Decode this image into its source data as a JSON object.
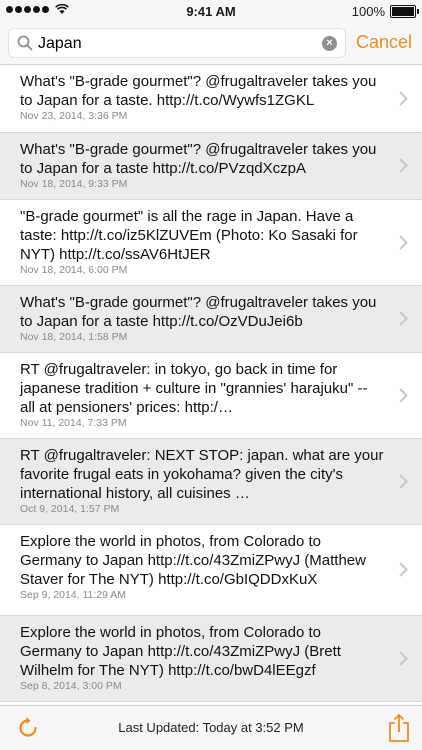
{
  "status": {
    "carrier_signal": "signal-dots",
    "time": "9:41 AM",
    "battery": "100%"
  },
  "search": {
    "value": "Japan",
    "cancel_label": "Cancel"
  },
  "colors": {
    "accent": "#f28a1e",
    "row_alt": "#ebebeb",
    "date_gray": "#8a8a8a"
  },
  "rows": [
    {
      "text": "What's \"B-grade gourmet\"? @frugaltraveler takes you to Japan for a taste. http://t.co/Wywfs1ZGKL",
      "date": "Nov 23, 2014, 3:36 PM"
    },
    {
      "text": "What's \"B-grade gourmet\"? @frugaltraveler takes you to Japan for a taste http://t.co/PVzqdXczpA",
      "date": "Nov 18, 2014, 9:33 PM"
    },
    {
      "text": "\"B-grade gourmet\" is all the rage in Japan. Have a taste: http://t.co/iz5KlZUVEm (Photo: Ko Sasaki for NYT) http://t.co/ssAV6HtJER",
      "date": "Nov 18, 2014, 6:00 PM"
    },
    {
      "text": "What's \"B-grade gourmet\"? @frugaltraveler takes you to Japan for a taste http://t.co/OzVDuJei6b",
      "date": "Nov 18, 2014, 1:58 PM"
    },
    {
      "text": "RT @frugaltraveler: in tokyo, go back in time for japanese tradition + culture in \"grannies' harajuku\" -- all at pensioners' prices: http:/…",
      "date": "Nov 11, 2014, 7:33 PM"
    },
    {
      "text": "RT @frugaltraveler: NEXT STOP: japan. what are your favorite frugal eats in yokohama? given the city's international history, all cuisines …",
      "date": "Oct 9, 2014, 1:57 PM"
    },
    {
      "text": "Explore the world in photos, from Colorado to Germany to Japan http://t.co/43ZmiZPwyJ (Matthew Staver for The NYT) http://t.co/GbIQDDxKuX",
      "date": "Sep 9, 2014, 11:29 AM"
    },
    {
      "text": "Explore the world in photos, from Colorado to Germany to Japan http://t.co/43ZmiZPwyJ (Brett Wilhelm for The NYT) http://t.co/bwD4lEEgzf",
      "date": "Sep 8, 2014, 3:00 PM"
    }
  ],
  "toolbar": {
    "updated": "Last Updated: Today at 3:52 PM",
    "refresh_icon": "refresh-icon",
    "share_icon": "share-icon"
  }
}
